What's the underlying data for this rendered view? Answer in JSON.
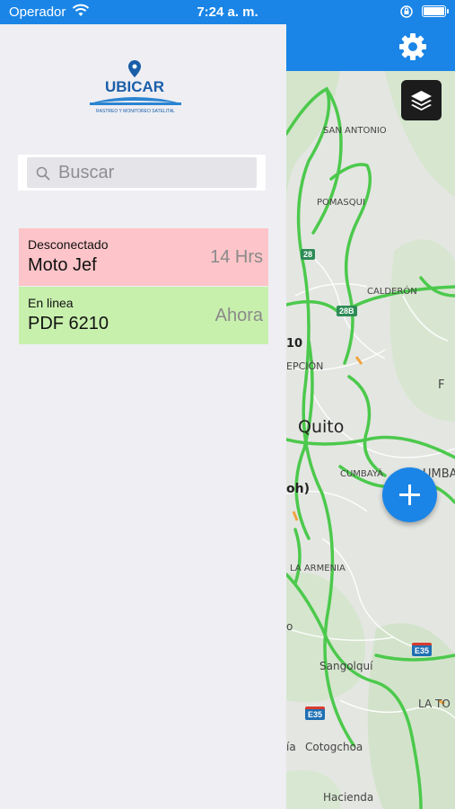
{
  "statusbar": {
    "carrier": "Operador",
    "time": "7:24 a. m."
  },
  "logo": {
    "brand": "UBICAR",
    "tagline": "RASTREO Y MONITOREO SATELITAL"
  },
  "search": {
    "placeholder": "Buscar"
  },
  "vehicles": [
    {
      "status": "Desconectado",
      "name": "Moto Jef",
      "last_seen": "14 Hrs",
      "color": "#fdc5c9"
    },
    {
      "status": "En linea",
      "name": "PDF 6210",
      "last_seen": "Ahora",
      "color": "#c8f0ad"
    }
  ],
  "map": {
    "labels": {
      "san_antonio": "SAN ANTONIO",
      "pomasqui": "POMASQUI",
      "calderon": "CALDERÓN",
      "ten": "10",
      "concepcion": "EPCIÓN",
      "quito": "Quito",
      "cumbaya": "CUMBAYÁ",
      "tumbaco": "UMBACO",
      "oh": "oh)",
      "la_armenia": "LA ARMENIA",
      "sangolqui": "Sangolquí",
      "la_to": "LA TO",
      "cotogchoa": "Cotogchoa",
      "ia": "ía",
      "hacienda": "Hacienda",
      "f_letter": "F",
      "o_letter": "o"
    },
    "shields": {
      "r28": "28",
      "r28b": "28B",
      "e35a": "E35",
      "e35b": "E35"
    }
  },
  "icons": {
    "settings": "gear-icon",
    "layers": "layers-icon",
    "add": "plus-icon",
    "search": "search-icon",
    "wifi": "wifi-icon",
    "lock": "rotation-lock-icon",
    "battery": "battery-icon"
  },
  "colors": {
    "brand_blue": "#1a85e6",
    "offline": "#fdc5c9",
    "online": "#c8f0ad"
  }
}
